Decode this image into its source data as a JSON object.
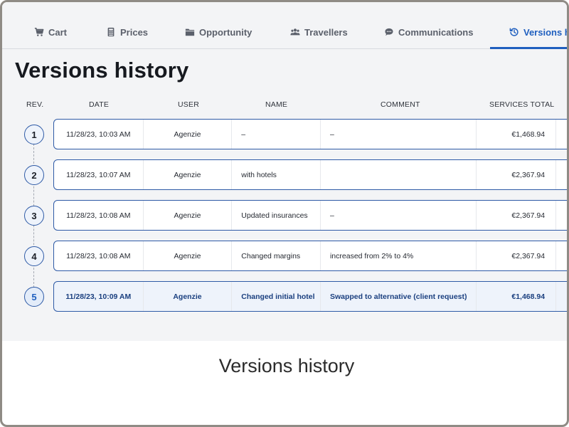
{
  "tabs": [
    {
      "label": "Cart",
      "icon": "cart-icon"
    },
    {
      "label": "Prices",
      "icon": "calculator-icon"
    },
    {
      "label": "Opportunity",
      "icon": "folder-icon"
    },
    {
      "label": "Travellers",
      "icon": "users-icon"
    },
    {
      "label": "Communications",
      "icon": "chat-bubble-icon"
    },
    {
      "label": "Versions hi",
      "icon": "history-icon",
      "active": true
    }
  ],
  "page": {
    "title": "Versions history"
  },
  "columns": {
    "rev": "REV.",
    "date": "DATE",
    "user": "USER",
    "name": "NAME",
    "comment": "COMMENT",
    "total": "SERVICES TOTAL"
  },
  "rows": [
    {
      "rev": "1",
      "date": "11/28/23, 10:03 AM",
      "user": "Agenzie",
      "name": "–",
      "comment": "–",
      "total": "€1,468.94"
    },
    {
      "rev": "2",
      "date": "11/28/23, 10:07 AM",
      "user": "Agenzie",
      "name": "with hotels",
      "comment": "",
      "total": "€2,367.94"
    },
    {
      "rev": "3",
      "date": "11/28/23, 10:08 AM",
      "user": "Agenzie",
      "name": "Updated insurances",
      "comment": "–",
      "total": "€2,367.94"
    },
    {
      "rev": "4",
      "date": "11/28/23, 10:08 AM",
      "user": "Agenzie",
      "name": "Changed margins",
      "comment": "increased from 2% to 4%",
      "total": "€2,367.94"
    },
    {
      "rev": "5",
      "date": "11/28/23, 10:09 AM",
      "user": "Agenzie",
      "name": "Changed initial hotel",
      "comment": "Swapped to alternative (client request)",
      "total": "€1,468.94",
      "active": true
    }
  ],
  "colors": {
    "accent": "#1f5fbf",
    "row_border": "#2e5aa6",
    "active_row_bg": "#eef3fb"
  },
  "caption": "Versions history"
}
